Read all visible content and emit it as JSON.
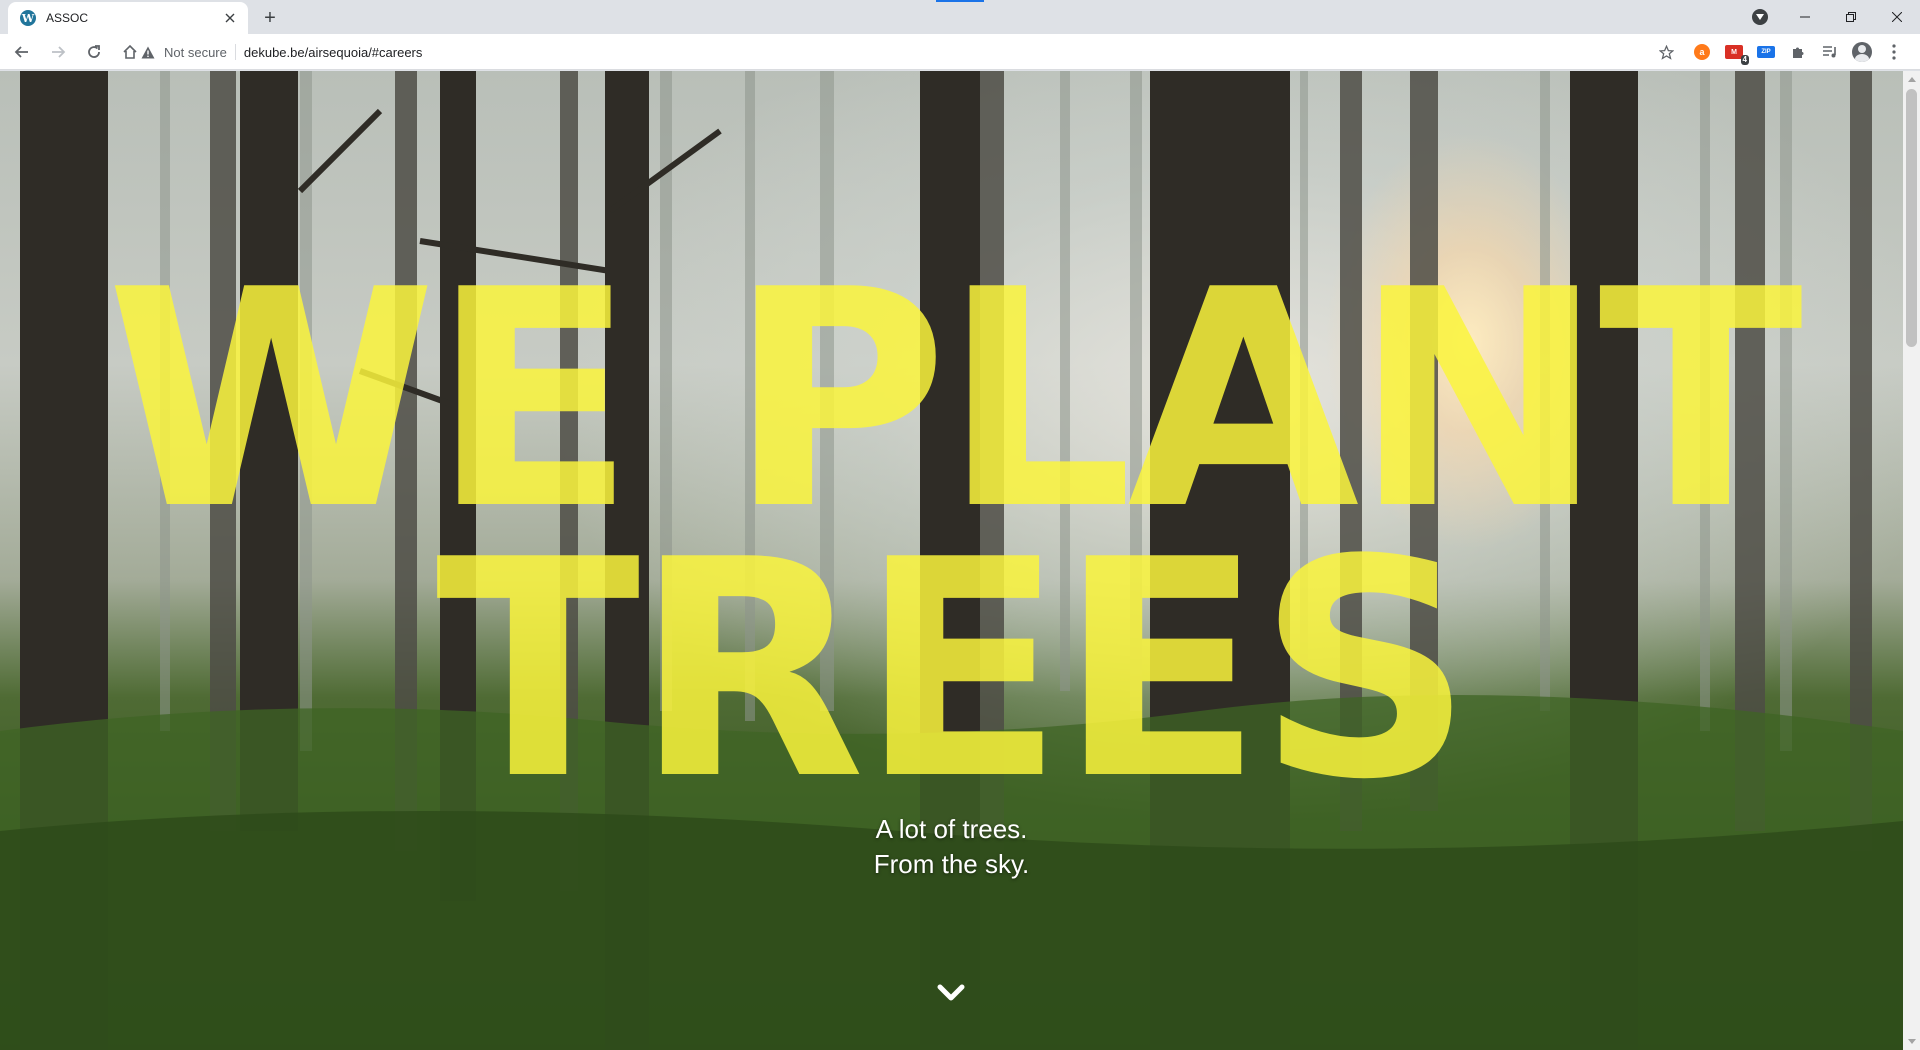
{
  "browser": {
    "tab": {
      "title": "ASSOC",
      "favicon": "wordpress-icon",
      "favicon_letter": "W"
    },
    "new_tab_label": "+",
    "address": {
      "security_label": "Not secure",
      "url": "dekube.be/airsequoia/#careers"
    },
    "extensions": {
      "mail_badge": "4",
      "mail_label": "M",
      "zip_label": "ZIP",
      "aliexpress_label": "a"
    },
    "colors": {
      "chrome_frame": "#dee1e6",
      "accent": "#1a73e8"
    }
  },
  "page": {
    "hero": {
      "line1": "WE PLANT",
      "line2": "TREES",
      "color": "#faf53c"
    },
    "subtitle": {
      "line1": "A lot of trees.",
      "line2": "From the sky."
    },
    "scroll_icon": "chevron-down-icon"
  }
}
